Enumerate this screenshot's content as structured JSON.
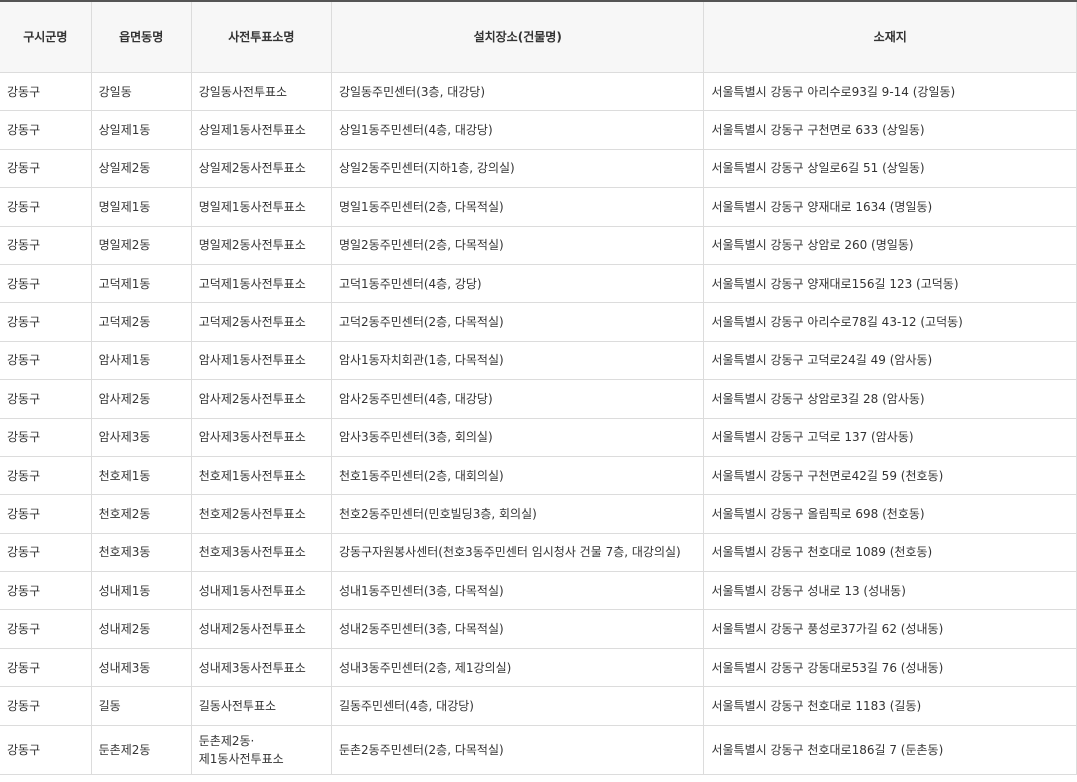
{
  "headers": [
    "구시군명",
    "읍면동명",
    "사전투표소명",
    "설치장소(건물명)",
    "소재지"
  ],
  "rows": [
    {
      "sigungu": "강동구",
      "dong": "강일동",
      "station": "강일동사전투표소",
      "place": "강일동주민센터(3층, 대강당)",
      "address": "서울특별시 강동구 아리수로93길 9-14 (강일동)"
    },
    {
      "sigungu": "강동구",
      "dong": "상일제1동",
      "station": "상일제1동사전투표소",
      "place": "상일1동주민센터(4층, 대강당)",
      "address": "서울특별시 강동구 구천면로 633 (상일동)"
    },
    {
      "sigungu": "강동구",
      "dong": "상일제2동",
      "station": "상일제2동사전투표소",
      "place": "상일2동주민센터(지하1층, 강의실)",
      "address": "서울특별시 강동구 상일로6길 51 (상일동)"
    },
    {
      "sigungu": "강동구",
      "dong": "명일제1동",
      "station": "명일제1동사전투표소",
      "place": "명일1동주민센터(2층, 다목적실)",
      "address": "서울특별시 강동구 양재대로 1634 (명일동)"
    },
    {
      "sigungu": "강동구",
      "dong": "명일제2동",
      "station": "명일제2동사전투표소",
      "place": "명일2동주민센터(2층, 다목적실)",
      "address": "서울특별시 강동구 상암로 260 (명일동)"
    },
    {
      "sigungu": "강동구",
      "dong": "고덕제1동",
      "station": "고덕제1동사전투표소",
      "place": "고덕1동주민센터(4층, 강당)",
      "address": "서울특별시 강동구 양재대로156길 123 (고덕동)"
    },
    {
      "sigungu": "강동구",
      "dong": "고덕제2동",
      "station": "고덕제2동사전투표소",
      "place": "고덕2동주민센터(2층, 다목적실)",
      "address": "서울특별시 강동구 아리수로78길 43-12 (고덕동)"
    },
    {
      "sigungu": "강동구",
      "dong": "암사제1동",
      "station": "암사제1동사전투표소",
      "place": "암사1동자치회관(1층, 다목적실)",
      "address": "서울특별시 강동구 고덕로24길 49 (암사동)"
    },
    {
      "sigungu": "강동구",
      "dong": "암사제2동",
      "station": "암사제2동사전투표소",
      "place": "암사2동주민센터(4층, 대강당)",
      "address": "서울특별시 강동구 상암로3길 28 (암사동)"
    },
    {
      "sigungu": "강동구",
      "dong": "암사제3동",
      "station": "암사제3동사전투표소",
      "place": "암사3동주민센터(3층, 회의실)",
      "address": "서울특별시 강동구 고덕로 137 (암사동)"
    },
    {
      "sigungu": "강동구",
      "dong": "천호제1동",
      "station": "천호제1동사전투표소",
      "place": "천호1동주민센터(2층, 대회의실)",
      "address": "서울특별시 강동구 구천면로42길 59 (천호동)"
    },
    {
      "sigungu": "강동구",
      "dong": "천호제2동",
      "station": "천호제2동사전투표소",
      "place": "천호2동주민센터(민호빌딩3층, 회의실)",
      "address": "서울특별시 강동구 올림픽로 698 (천호동)"
    },
    {
      "sigungu": "강동구",
      "dong": "천호제3동",
      "station": "천호제3동사전투표소",
      "place": "강동구자원봉사센터(천호3동주민센터 임시청사 건물 7층, 대강의실)",
      "address": "서울특별시 강동구 천호대로 1089 (천호동)"
    },
    {
      "sigungu": "강동구",
      "dong": "성내제1동",
      "station": "성내제1동사전투표소",
      "place": "성내1동주민센터(3층, 다목적실)",
      "address": "서울특별시 강동구 성내로 13 (성내동)"
    },
    {
      "sigungu": "강동구",
      "dong": "성내제2동",
      "station": "성내제2동사전투표소",
      "place": "성내2동주민센터(3층, 다목적실)",
      "address": "서울특별시 강동구 풍성로37가길 62 (성내동)"
    },
    {
      "sigungu": "강동구",
      "dong": "성내제3동",
      "station": "성내제3동사전투표소",
      "place": "성내3동주민센터(2층, 제1강의실)",
      "address": "서울특별시 강동구 강동대로53길 76 (성내동)"
    },
    {
      "sigungu": "강동구",
      "dong": "길동",
      "station": "길동사전투표소",
      "place": "길동주민센터(4층, 대강당)",
      "address": "서울특별시 강동구 천호대로 1183 (길동)"
    }
  ],
  "last_row": {
    "sigungu": "강동구",
    "dong": "둔촌제2동",
    "station_line1": "둔촌제2동·",
    "station_line2": "제1동사전투표소",
    "place": "둔촌2동주민센터(2층, 다목적실)",
    "address": "서울특별시 강동구 천호대로186길 7 (둔촌동)"
  }
}
